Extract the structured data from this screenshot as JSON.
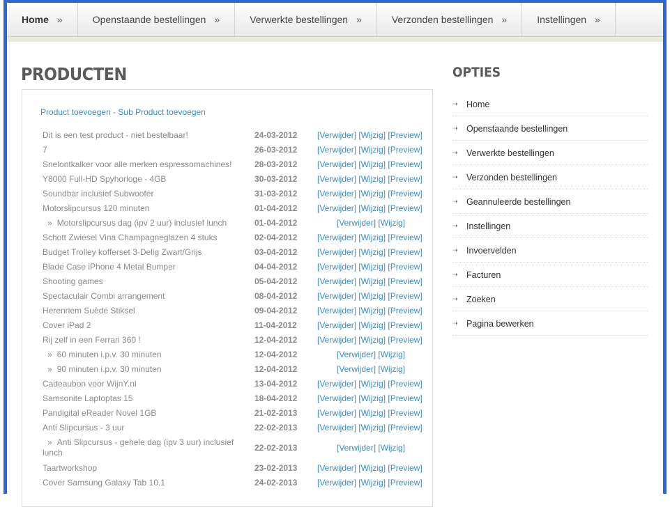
{
  "nav": {
    "separator": "»",
    "items": [
      {
        "label": "Home",
        "active": true
      },
      {
        "label": "Openstaande bestellingen"
      },
      {
        "label": "Verwerkte bestellingen"
      },
      {
        "label": "Verzonden bestellingen"
      },
      {
        "label": "Instellingen"
      }
    ]
  },
  "main": {
    "title": "PRODUCTEN",
    "add_product": "Product toevoegen",
    "add_separator": " - ",
    "add_subproduct": "Sub Product toevoegen",
    "action_delete": "[Verwijder]",
    "action_edit": "[Wijzig]",
    "action_preview": "[Preview]",
    "sub_marker": "»",
    "products": [
      {
        "name": "Dit is een test product - niet bestelbaar!",
        "date": "24-03-2012"
      },
      {
        "name": "7",
        "date": "26-03-2012"
      },
      {
        "name": "Snelontkalker voor alle merken espressomachines!",
        "date": "28-03-2012"
      },
      {
        "name": "Y8000 Full-HD Spyhorloge - 4GB",
        "date": "30-03-2012"
      },
      {
        "name": "Soundbar inclusief Subwoofer",
        "date": "31-03-2012"
      },
      {
        "name": "Motorslipcursus 120 minuten",
        "date": "01-04-2012"
      },
      {
        "name": "Motorslipcursus dag (ipv 2 uur) inclusief lunch",
        "date": "01-04-2012",
        "sub": true
      },
      {
        "name": "Schott Zwiesel Vina Champagneglazen 4 stuks",
        "date": "02-04-2012"
      },
      {
        "name": "Budget Trolley kofferset 3-Delig Zwart/Grijs",
        "date": "03-04-2012"
      },
      {
        "name": "Blade Case iPhone 4 Metal Bumper",
        "date": "04-04-2012"
      },
      {
        "name": "Shooting games",
        "date": "05-04-2012"
      },
      {
        "name": "Spectaculair Combi arrangement",
        "date": "08-04-2012"
      },
      {
        "name": "Herenriem Suède Stiksel",
        "date": "09-04-2012"
      },
      {
        "name": "Cover iPad 2",
        "date": "11-04-2012"
      },
      {
        "name": "Rij zelf in een Ferrari 360 !",
        "date": "12-04-2012"
      },
      {
        "name": "60 minuten i.p.v. 30 minuten",
        "date": "12-04-2012",
        "sub": true
      },
      {
        "name": "90 minuten i.p.v. 30 minuten",
        "date": "12-04-2012",
        "sub": true
      },
      {
        "name": "Cadeaubon voor WijnY.nl",
        "date": "13-04-2012"
      },
      {
        "name": "Samsonite Laptoptas 15",
        "date": "18-04-2012"
      },
      {
        "name": "Pandigital eReader Novel 1GB",
        "date": "21-02-2013"
      },
      {
        "name": "Anti Slipcursus - 3 uur",
        "date": "22-02-2013"
      },
      {
        "name": "Anti Slipcursus - gehele dag (ipv 3 uur) inclusief lunch",
        "date": "22-02-2013",
        "sub": true,
        "tall": true
      },
      {
        "name": "Taartworkshop",
        "date": "23-02-2013"
      },
      {
        "name": "Cover Samsung Galaxy Tab 10.1",
        "date": "24-02-2013"
      }
    ]
  },
  "sidebar": {
    "title": "OPTIES",
    "arrow_icon": "arrow-right-icon",
    "items": [
      {
        "label": "Home"
      },
      {
        "label": "Openstaande bestellingen"
      },
      {
        "label": "Verwerkte bestellingen"
      },
      {
        "label": "Verzonden bestellingen"
      },
      {
        "label": "Geannuleerde bestellingen"
      },
      {
        "label": "Instellingen"
      },
      {
        "label": "Invoervelden"
      },
      {
        "label": "Facturen"
      },
      {
        "label": "Zoeken"
      },
      {
        "label": "Pagina bewerken"
      }
    ]
  },
  "colors": {
    "frame": "#2d67d0",
    "link": "#3b8ec2",
    "text": "#8a8a8a",
    "heading": "#5a5a5a"
  }
}
